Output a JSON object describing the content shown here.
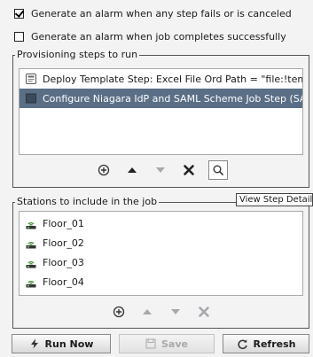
{
  "options": {
    "alarm_on_fail": {
      "label": "Generate an alarm when any step fails or is canceled",
      "checked": true
    },
    "alarm_on_complete": {
      "label": "Generate an alarm when job completes successfully",
      "checked": false
    }
  },
  "steps_group": {
    "legend": "Provisioning steps to run",
    "items": [
      {
        "label": "Deploy Template Step: Excel File Ord Path = \"file:!temp",
        "icon": "template-step-icon",
        "selected": false
      },
      {
        "label": "Configure Niagara IdP and SAML Scheme Job Step (SA",
        "icon": "step-icon",
        "selected": true
      }
    ]
  },
  "stations_group": {
    "legend": "Stations to include in the job",
    "items": [
      {
        "label": "Floor_01",
        "icon": "station-icon"
      },
      {
        "label": "Floor_02",
        "icon": "station-icon"
      },
      {
        "label": "Floor_03",
        "icon": "station-icon"
      },
      {
        "label": "Floor_04",
        "icon": "station-icon"
      }
    ]
  },
  "tooltip": "View Step Details",
  "buttons": {
    "run_now": "Run Now",
    "save": "Save",
    "refresh": "Refresh"
  },
  "colors": {
    "selection": "#5a6e86",
    "station_green": "#3a8a2a"
  }
}
